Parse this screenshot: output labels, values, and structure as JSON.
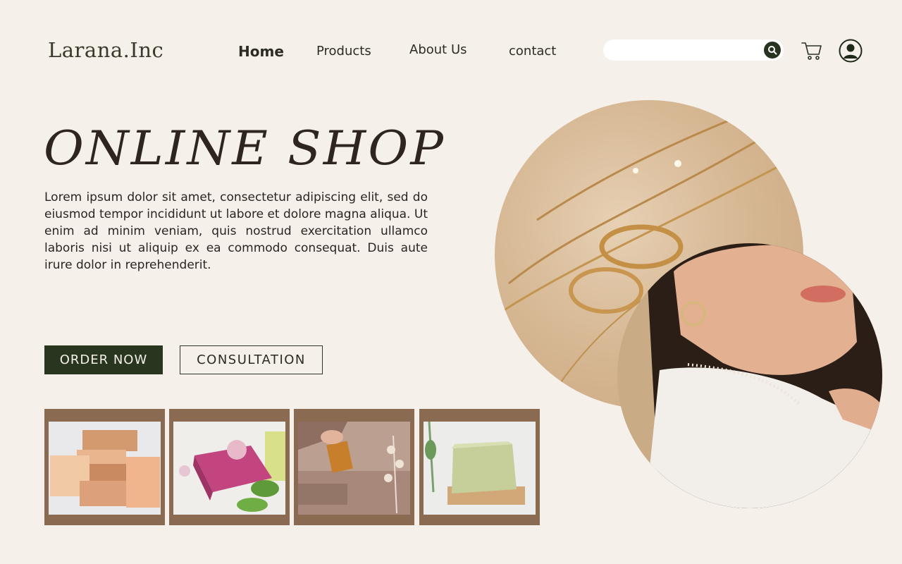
{
  "header": {
    "logo": "Larana.Inc",
    "nav": [
      {
        "label": "Home"
      },
      {
        "label": "Products"
      },
      {
        "label": "About Us"
      },
      {
        "label": "contact"
      }
    ],
    "search": {
      "placeholder": "",
      "value": ""
    },
    "icons": [
      "search-icon",
      "cart-icon",
      "user-icon"
    ]
  },
  "hero": {
    "title": "ONLINE SHOP",
    "body": "Lorem ipsum dolor sit amet, consectetur adipiscing elit, sed do eiusmod tempor incididunt ut labore et dolore magna aliqua. Ut enim ad minim veniam, quis nostrud exercitation ullamco laboris nisi ut aliquip ex ea commodo consequat. Duis aute irure dolor in reprehenderit.",
    "primary_button": "ORDER NOW",
    "secondary_button": "CONSULTATION"
  },
  "colors": {
    "background": "#f6f0ea",
    "accent_dark_green": "#28361f",
    "thumb_frame": "#8b6a52",
    "text": "#2b2420"
  }
}
